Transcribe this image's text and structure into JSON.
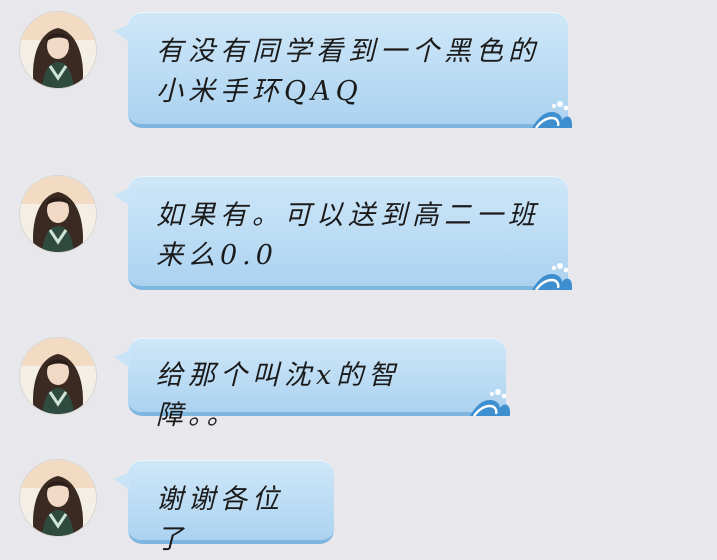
{
  "messages": [
    {
      "text": "有没有同学看到一个黑色的小米手环QAQ"
    },
    {
      "text": "如果有。可以送到高二一班来么0.0"
    },
    {
      "text": "给那个叫沈x的智障。。"
    },
    {
      "text": "谢谢各位了"
    }
  ],
  "icons": {
    "avatar": "user-avatar-illustration",
    "bubble_decoration": "wave-icon"
  },
  "colors": {
    "background": "#e8e8ec",
    "bubble_fill": "#c3e0f6",
    "bubble_border": "#7fb6e0",
    "text": "#1b1b1b"
  }
}
